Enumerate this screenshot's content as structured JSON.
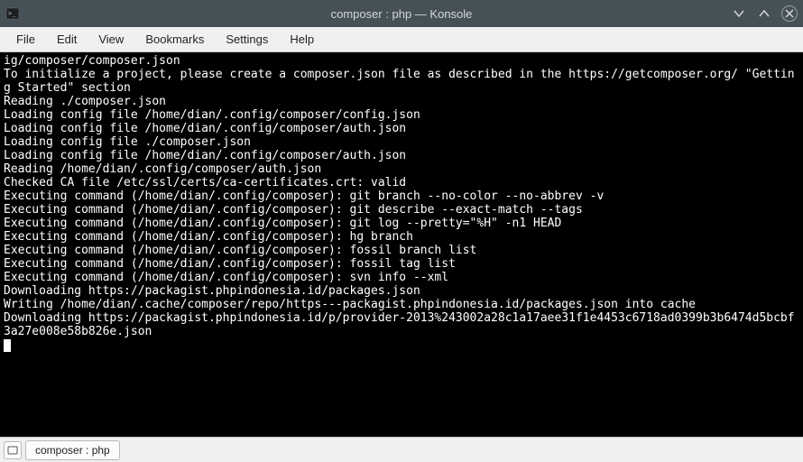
{
  "window": {
    "title": "composer : php — Konsole"
  },
  "menubar": {
    "items": [
      "File",
      "Edit",
      "View",
      "Bookmarks",
      "Settings",
      "Help"
    ]
  },
  "terminal": {
    "lines": [
      "ig/composer/composer.json",
      "To initialize a project, please create a composer.json file as described in the https://getcomposer.org/ \"Getting Started\" section",
      "Reading ./composer.json",
      "Loading config file /home/dian/.config/composer/config.json",
      "Loading config file /home/dian/.config/composer/auth.json",
      "Loading config file ./composer.json",
      "Loading config file /home/dian/.config/composer/auth.json",
      "Reading /home/dian/.config/composer/auth.json",
      "Checked CA file /etc/ssl/certs/ca-certificates.crt: valid",
      "Executing command (/home/dian/.config/composer): git branch --no-color --no-abbrev -v",
      "Executing command (/home/dian/.config/composer): git describe --exact-match --tags",
      "Executing command (/home/dian/.config/composer): git log --pretty=\"%H\" -n1 HEAD",
      "Executing command (/home/dian/.config/composer): hg branch",
      "Executing command (/home/dian/.config/composer): fossil branch list",
      "Executing command (/home/dian/.config/composer): fossil tag list",
      "Executing command (/home/dian/.config/composer): svn info --xml",
      "Downloading https://packagist.phpindonesia.id/packages.json",
      "Writing /home/dian/.cache/composer/repo/https---packagist.phpindonesia.id/packages.json into cache",
      "Downloading https://packagist.phpindonesia.id/p/provider-2013%243002a28c1a17aee31f1e4453c6718ad0399b3b6474d5bcbf3a27e008e58b826e.json"
    ]
  },
  "tabs": {
    "active": "composer : php"
  }
}
